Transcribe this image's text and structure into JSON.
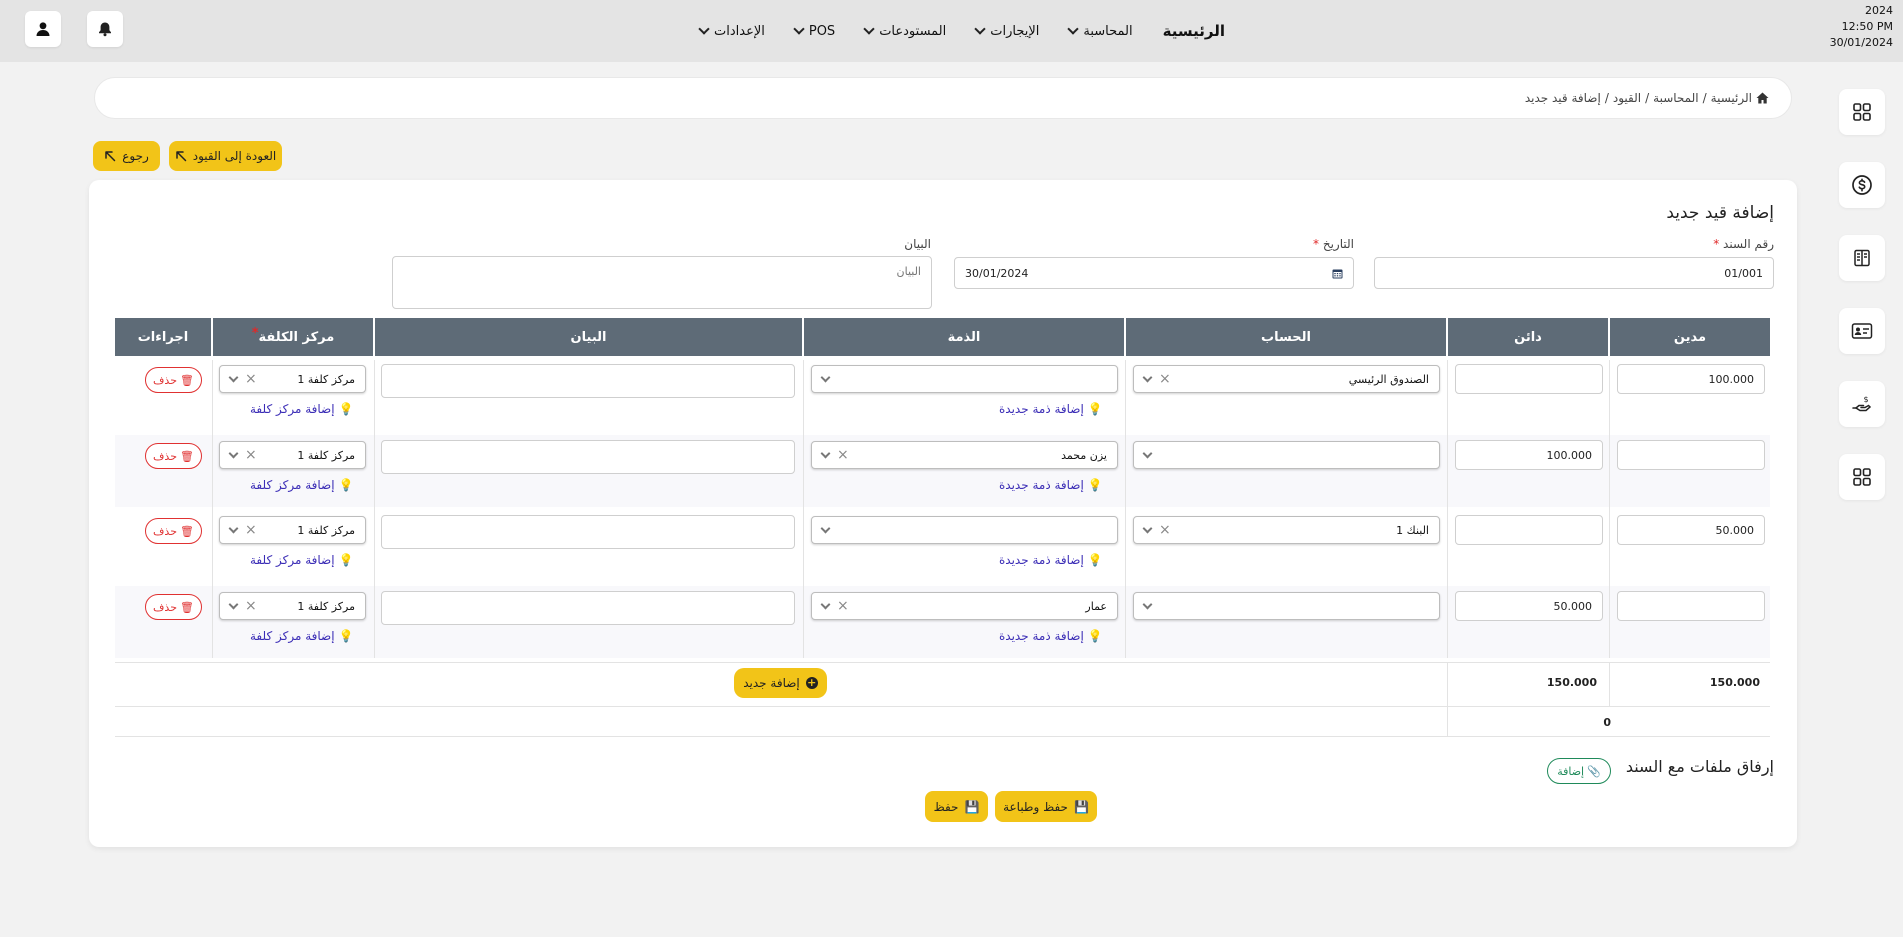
{
  "header": {
    "clock": {
      "year": "2024",
      "time": "12:50 PM",
      "date": "30/01/2024"
    },
    "nav": [
      {
        "label": "الرئيسية"
      },
      {
        "label": "المحاسبة"
      },
      {
        "label": "الإيجارات"
      },
      {
        "label": "المستودعات"
      },
      {
        "label": "POS"
      },
      {
        "label": "الإعدادات"
      }
    ]
  },
  "breadcrumb": {
    "items": [
      "الرئيسية",
      "المحاسبة",
      "القيود",
      "إضافة قيد جديد"
    ],
    "separator": "/"
  },
  "actions": {
    "back_to_entries": "العودة إلى القيود",
    "back": "رجوع"
  },
  "form": {
    "title": "إضافة قيد جديد",
    "doc_number_label": "رقم السند",
    "doc_number_value": "01/001",
    "date_label": "التاريخ",
    "date_value": "30/01/2024",
    "statement_label": "البيان",
    "statement_placeholder": "البيان",
    "required_mark": "*"
  },
  "table": {
    "headers": {
      "debit": "مدين",
      "credit": "دائن",
      "account": "الحساب",
      "party": "الذمة",
      "statement": "البيان",
      "cost_center": "مركز الكلفة",
      "actions": "اجراءات"
    },
    "rows": [
      {
        "debit": "100.000",
        "credit": "",
        "account": "الصندوق الرئيسي",
        "party": "",
        "cost_center": "مركز كلفة 1"
      },
      {
        "debit": "",
        "credit": "100.000",
        "account": "",
        "party": "يزن محمد",
        "cost_center": "مركز كلفة 1"
      },
      {
        "debit": "50.000",
        "credit": "",
        "account": "البنك 1",
        "party": "",
        "cost_center": "مركز كلفة 1"
      },
      {
        "debit": "",
        "credit": "50.000",
        "account": "",
        "party": "عمار",
        "cost_center": "مركز كلفة 1"
      }
    ],
    "add_party_link": "إضافة ذمة جديدة",
    "add_cost_center_link": "إضافة مركز كلفة",
    "delete_label": "حذف",
    "add_new_label": "إضافة جديد",
    "total_debit": "150.000",
    "total_credit": "150.000",
    "difference": "0"
  },
  "attachments": {
    "title": "إرفاق ملفات مع السند",
    "add_label": "إضافة"
  },
  "footer": {
    "save_print": "حفظ وطباعة",
    "save": "حفظ"
  },
  "colors": {
    "accent_yellow": "#f2c418",
    "table_header": "#5e6b77",
    "link": "#3b2db6",
    "danger": "#e03131",
    "attach_green": "#1f8a5a"
  }
}
